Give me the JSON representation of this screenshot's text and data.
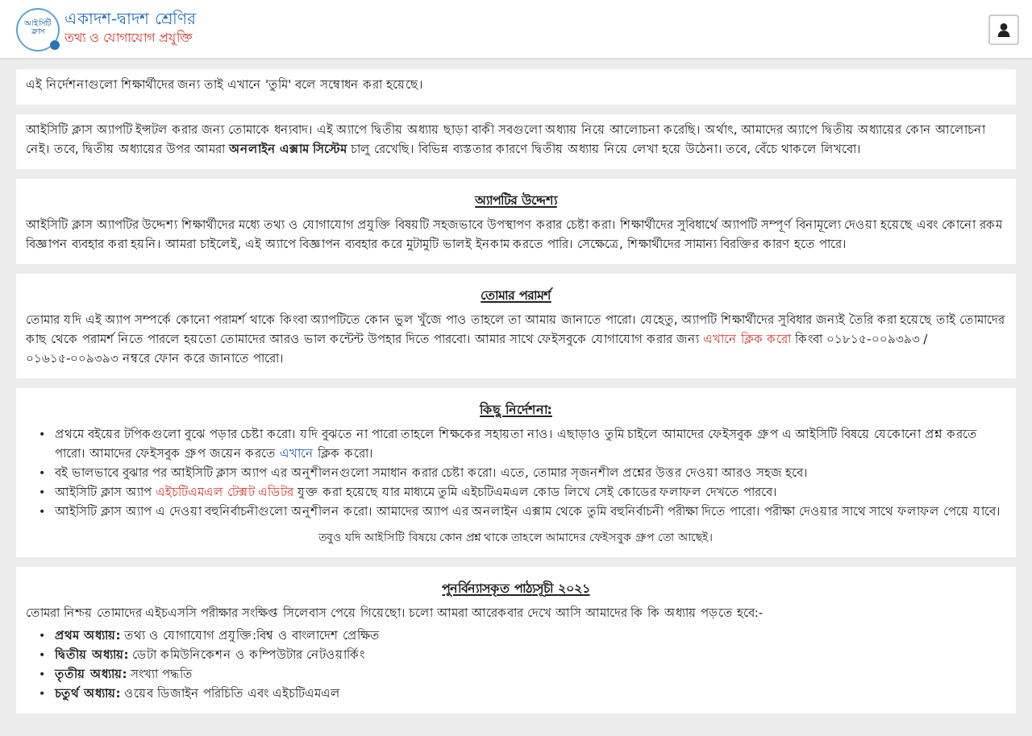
{
  "header": {
    "logo_text": "আইসিটি ক্লাস",
    "title": "একাদশ-দ্বাদশ শ্রেণির",
    "subtitle": "তথ্য ও যোগাযোগ প্রযুক্তি"
  },
  "cards": [
    {
      "kind": "plain",
      "paragraph": [
        {
          "kind": "text",
          "text": "এই নির্দেশনাগুলো শিক্ষার্থীদের জন্য তাই এখানে 'তুমি' বলে সম্বোধন করা হয়েছে।"
        }
      ]
    },
    {
      "kind": "plain",
      "paragraph": [
        {
          "kind": "text",
          "text": "আইসিটি ক্লাস অ্যাপটি ইন্সটল করার জন্য তোমাকে ধন্যবাদ। এই অ্যাপে দ্বিতীয় অধ্যায় ছাড়া বাকী সবগুলো অধ্যায় নিয়ে আলোচনা করেছি। অর্থাৎ, আমাদের অ্যাপে দ্বিতীয় অধ্যায়ের কোন আলোচনা নেই। তবে, দ্বিতীয় অধ্যায়ের উপর আমরা **অনলাইন এক্সাম সিস্টেম** চালু রেখেছি। বিভিন্ন ব্যস্ততার কারণে দ্বিতীয় অধ্যায় নিয়ে লেখা হয়ে উঠেনা। তবে, বেঁচে থাকলে লিখবো।"
        }
      ]
    },
    {
      "kind": "plain",
      "heading": "অ্যাপটির উদ্দেশ্য",
      "paragraph": [
        {
          "kind": "text",
          "text": "আইসিটি ক্লাস অ্যাপটির উদ্দেশ্য শিক্ষার্থীদের মধ্যে তথ্য ও যোগাযোগ প্রযুক্তি বিষয়টি সহজভাবে উপস্থাপণ করার চেষ্টা করা। শিক্ষার্থীদের সুবিধার্থে অ্যাপটি সম্পূর্ণ বিনামূল্যে দেওয়া হয়েছে এবং কোনো রকম বিজ্ঞাপন ব্যবহার করা হয়নি। আমরা চাইলেই, এই অ্যাপে বিজ্ঞাপন ব্যবহার করে মুটামুটি ভালই ইনকাম করতে পারি। সেক্ষেত্রে, শিক্ষার্থীদের সামান্য বিরক্তির কারণ হতে পারে।"
        }
      ]
    },
    {
      "kind": "plain",
      "heading": "তোমার পরামর্শ",
      "paragraph": [
        {
          "kind": "text",
          "text": "তোমার যদি এই অ্যাপ সম্পর্কে কোনো পরামর্শ থাকে কিংবা অ্যাপটিতে কোন ভুল খুঁজে পাও তাহলে তা আমায় জানাতে পারো। যেহেতু, অ্যাপটি শিক্ষার্থীদের সুবিধার জন্যই তৈরি করা হয়েছে তাই তোমাদের কাছ থেকে পরামর্শ নিতে পারলে হয়তো তোমাদের আরও ভাল কন্টেন্ট উপহার দিতে পারবো। আমার সাথে ফেইসবুকে যোগাযোগ করার জন্য "
        },
        {
          "kind": "link",
          "color": "#d9342b",
          "text": "এখানে ক্লিক করো"
        },
        {
          "kind": "text",
          "text": " কিংবা ০১৮১৫-০০৯৩৯৩ / ০১৬১৫-০০৯৩৯৩ নম্বরে ফোন করে জানাতে পারো।"
        }
      ]
    },
    {
      "kind": "bullets",
      "heading": "কিছু নির্দেশনা:",
      "bullet": "•",
      "items": [
        [
          {
            "kind": "text",
            "text": "প্রথমে বইয়ের টপিকগুলো বুঝে পড়ার চেষ্টা করো। যদি বুঝতে না পারো তাহলে শিক্ষকের সহায়তা নাও। এছাড়াও তুমি চাইলে আমাদের ফেইসবুক গ্রুপ এ আইসিটি বিষয়ে যেকোনো প্রশ্ন করতে পারো। আমাদের ফেইসবুক গ্রুপ জয়েন করতে "
          },
          {
            "kind": "link",
            "color": "#1f5fa8",
            "text": "এখানে"
          },
          {
            "kind": "text",
            "text": " ক্লিক করো।"
          }
        ],
        [
          {
            "kind": "text",
            "text": "বই ভালভাবে বুঝার পর আইসিটি ক্লাস অ্যাপ এর অনুশীলনগুলো সমাধান করার চেষ্টা করো। এতে, তোমার সৃজনশীল প্রশ্নের উত্তর দেওয়া আরও সহজ হবে।"
          }
        ],
        [
          {
            "kind": "text",
            "text": "আইসিটি ক্লাস অ্যাপ "
          },
          {
            "kind": "link",
            "color": "#d9342b",
            "text": "এইচটিএমএল টেক্সট এডিটর"
          },
          {
            "kind": "text",
            "text": " যুক্ত করা হয়েছে যার মাধ্যমে তুমি এইচটিএমএল কোড লিখে সেই কোডের ফলাফল দেখতে পারবে।"
          }
        ],
        [
          {
            "kind": "text",
            "text": "আইসিটি ক্লাস অ্যাপ এ দেওয়া বহুনির্বাচনীগুলো অনুশীলন করো। আমাদের অ্যাপ এর অনলাইন এক্সাম থেকে তুমি বহুনির্বাচনী পরীক্ষা দিতে পারো। পরীক্ষা দেওয়ার সাথে সাথে ফলাফল পেয়ে যাবে।"
          }
        ]
      ],
      "note": "তবুও যদি আইসিটি বিষয়ে কোন প্রশ্ন থাকে তাহলে আমাদের ফেইসবুক গ্রুপ তো আছেই।"
    },
    {
      "kind": "bullets",
      "heading": "পুনর্বিন্যাসকৃত পাঠ্যসূচী ২০২১",
      "bullet": "•",
      "paragraph": [
        {
          "kind": "text",
          "text": "তোমরা নিশ্চয় তোমাদের এইচএসসি পরীক্ষার সংক্ষিপ্ত সিলেবাস পেয়ে গিয়েছো। চলো আমরা আরেকবার দেখে আসি আমাদের কি কি অধ্যায় পড়তে হবে:-"
        }
      ],
      "items": [
        [
          {
            "kind": "text",
            "text": "**প্রথম অধ্যায়:** তথ্য ও যোগাযোগ প্রযুক্তি:বিশ্ব ও বাংলাদেশ প্রেক্ষিত"
          }
        ],
        [
          {
            "kind": "text",
            "text": "**দ্বিতীয় অধ্যায়:** ডেটা কমিউনিকেশন ও কম্পিউটার নেটওয়ার্কিং"
          }
        ],
        [
          {
            "kind": "text",
            "text": "**তৃতীয় অধ্যায়:** সংখ্যা পদ্ধতি"
          }
        ],
        [
          {
            "kind": "text",
            "text": "**চতুর্থ অধ্যায়:** ওয়েব ডিজাইন পরিচিতি এবং এইচটিএমএল"
          }
        ]
      ]
    }
  ]
}
